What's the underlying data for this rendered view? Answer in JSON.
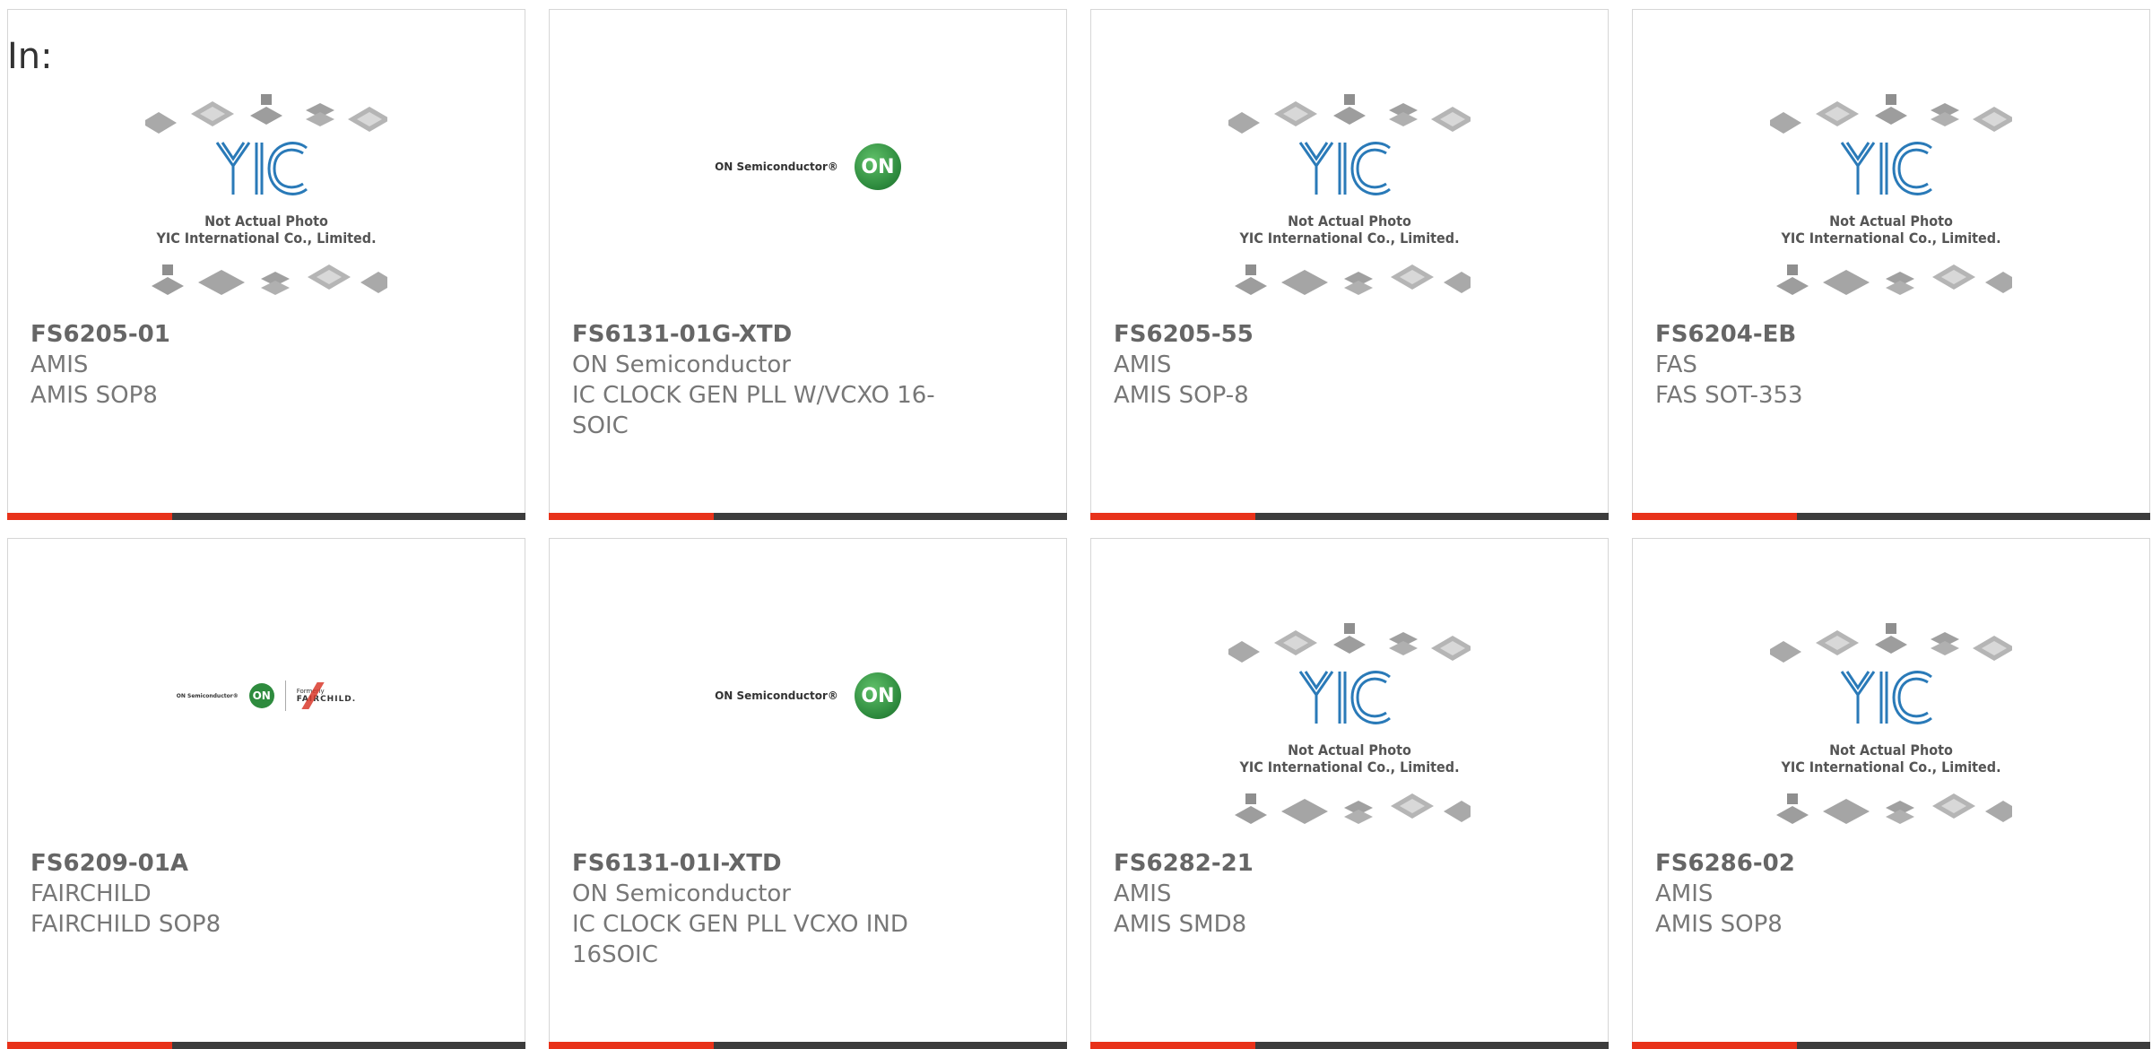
{
  "page": {
    "in_label": "In:"
  },
  "cards": [
    {
      "part_number": "FS6205-01",
      "manufacturer": "AMIS",
      "description": "AMIS SOP8",
      "image": "yic-placeholder",
      "yic_line1": "Not Actual Photo",
      "yic_line2": "YIC International Co., Limited."
    },
    {
      "part_number": "FS6131-01G-XTD",
      "manufacturer": "ON Semiconductor",
      "description": "IC CLOCK GEN PLL W/VCXO 16-SOIC",
      "image": "on-semi-logo",
      "logo_text": "ON Semiconductor®",
      "logo_badge": "ON"
    },
    {
      "part_number": "FS6205-55",
      "manufacturer": "AMIS",
      "description": "AMIS SOP-8",
      "image": "yic-placeholder",
      "yic_line1": "Not Actual Photo",
      "yic_line2": "YIC International Co., Limited."
    },
    {
      "part_number": "FS6204-EB",
      "manufacturer": "FAS",
      "description": "FAS SOT-353",
      "image": "yic-placeholder",
      "yic_line1": "Not Actual Photo",
      "yic_line2": "YIC International Co., Limited."
    },
    {
      "part_number": "FS6209-01A",
      "manufacturer": "FAIRCHILD",
      "description": "FAIRCHILD SOP8",
      "image": "on-fairchild-logo",
      "logo_text": "ON Semiconductor®",
      "logo_badge": "ON",
      "logo_formerly": "Formerly",
      "logo_fairchild": "FAIRCHILD."
    },
    {
      "part_number": "FS6131-01I-XTD",
      "manufacturer": "ON Semiconductor",
      "description": "IC CLOCK GEN PLL VCXO IND 16SOIC",
      "image": "on-semi-logo",
      "logo_text": "ON Semiconductor®",
      "logo_badge": "ON"
    },
    {
      "part_number": "FS6282-21",
      "manufacturer": "AMIS",
      "description": "AMIS SMD8",
      "image": "yic-placeholder",
      "yic_line1": "Not Actual Photo",
      "yic_line2": "YIC International Co., Limited."
    },
    {
      "part_number": "FS6286-02",
      "manufacturer": "AMIS",
      "description": "AMIS SOP8",
      "image": "yic-placeholder",
      "yic_line1": "Not Actual Photo",
      "yic_line2": "YIC International Co., Limited."
    }
  ],
  "colors": {
    "accent": "#e8321a",
    "bar": "#3c3c3c",
    "yic_blue": "#2a7ab8",
    "on_green": "#2e8b3e",
    "fairchild_red": "#d93a2b"
  }
}
